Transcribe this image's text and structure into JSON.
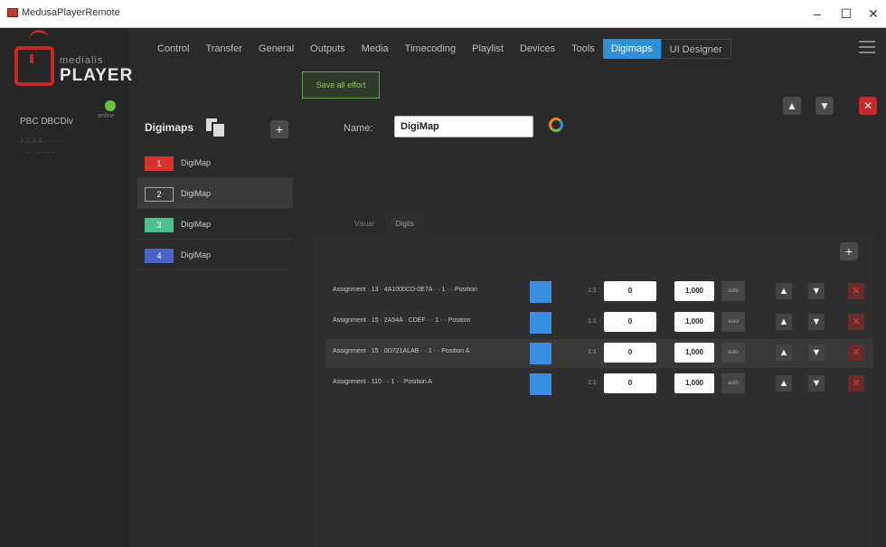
{
  "window": {
    "title": "MedusaPlayerRemote",
    "min": "–",
    "max": "☐",
    "close": "✕"
  },
  "logo": {
    "small": "medialis",
    "big": "PLAYER"
  },
  "server": {
    "name": "PBC DBCDiv",
    "status_label": "online",
    "status_color": "#6bc13b",
    "info_lines": [
      "1.2.3.4 ·· ·· · ··",
      "· ·· · ·· ··· · ··"
    ]
  },
  "nav": {
    "tabs": [
      "Control",
      "Transfer",
      "General",
      "Outputs",
      "Media",
      "Timecoding",
      "Playlist",
      "Devices",
      "Tools",
      "Digimaps",
      "UI Designer"
    ],
    "active": "Digimaps",
    "accent": "#2d8fd5"
  },
  "toolbar": {
    "save_label": "Save all effort"
  },
  "digimaps": {
    "header": "Digimaps",
    "items": [
      {
        "number": "1",
        "label": "DigiMap",
        "color": "#d9322e"
      },
      {
        "number": "2",
        "label": "DigiMap",
        "color": "#3a3a3a"
      },
      {
        "number": "3",
        "label": "DigiMap",
        "color": "#4fc08d"
      },
      {
        "number": "4",
        "label": "DigiMap",
        "color": "#4a63c9"
      }
    ]
  },
  "editor": {
    "name_label": "Name:",
    "name_value": "DigiMap",
    "tabs": [
      "Visual",
      "Digits"
    ],
    "active_tab": "Digits"
  },
  "assignments": [
    {
      "text": "Assignment · 13 · 4A1000CD-0E7A · · 1 · · Position",
      "range_label": "1:1",
      "from": "0",
      "to": "1,000",
      "mode": "auto"
    },
    {
      "text": "Assignment · 15 · 2A54A · CDEF · · 1 · · Position",
      "range_label": "1:1",
      "from": "0",
      "to": "1,000",
      "mode": "auto"
    },
    {
      "text": "Assignment · 15 · 0D721ALAB · · 1 · · Position A",
      "range_label": "1:1",
      "from": "0",
      "to": "1,000",
      "mode": "auto"
    },
    {
      "text": "Assignment · 110 · · 1 · · Position A",
      "range_label": "1:1",
      "from": "0",
      "to": "1,000",
      "mode": "auto"
    }
  ],
  "icons": {
    "up": "arrow-up-icon",
    "down": "arrow-down-icon",
    "delete": "delete-icon",
    "add": "plus-icon",
    "copy": "copy-icon",
    "menu": "hamburger-menu-icon"
  }
}
